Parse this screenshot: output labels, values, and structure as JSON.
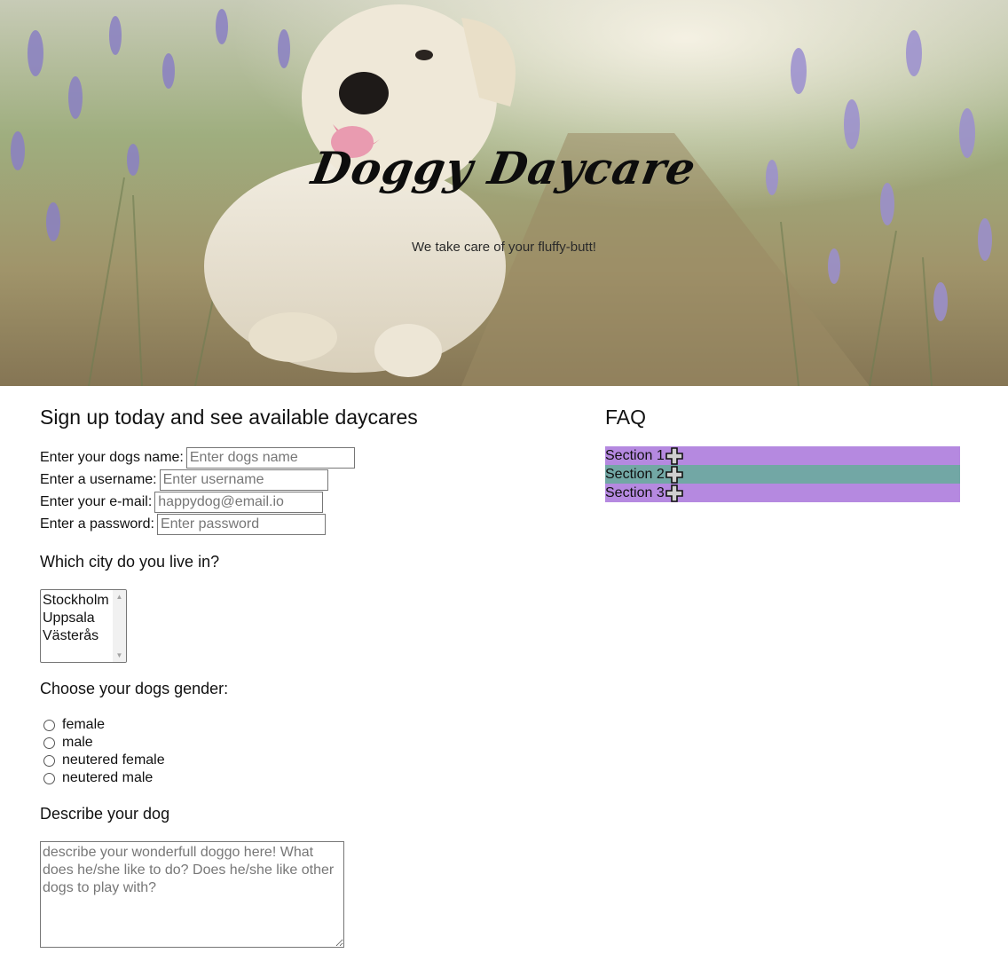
{
  "hero": {
    "title": "Doggy Daycare",
    "subtitle": "We take care of your fluffy-butt!"
  },
  "signup": {
    "title": "Sign up today and see available daycares",
    "fields": [
      {
        "label": "Enter your dogs name:",
        "placeholder": "Enter dogs name"
      },
      {
        "label": "Enter a username:",
        "placeholder": "Enter username"
      },
      {
        "label": "Enter your e-mail:",
        "placeholder": "happydog@email.io"
      },
      {
        "label": "Enter a password:",
        "placeholder": "Enter password"
      }
    ],
    "city_question": "Which city do you live in?",
    "cities": [
      "Stockholm",
      "Uppsala",
      "Västerås"
    ],
    "gender_question": "Choose your dogs gender:",
    "genders": [
      "female",
      "male",
      "neutered female",
      "neutered male"
    ],
    "describe_title": "Describe your dog",
    "describe_placeholder": "describe your wonderfull doggo here! What does he/she like to do? Does he/she like other dogs to play with?"
  },
  "faq": {
    "title": "FAQ",
    "sections": [
      {
        "label": "Section 1",
        "color": "#b589e0",
        "icon": "plus-icon"
      },
      {
        "label": "Section 2",
        "color": "#72a7a5",
        "icon": "plus-icon"
      },
      {
        "label": "Section 3",
        "color": "#b589e0",
        "icon": "plus-icon"
      }
    ]
  }
}
